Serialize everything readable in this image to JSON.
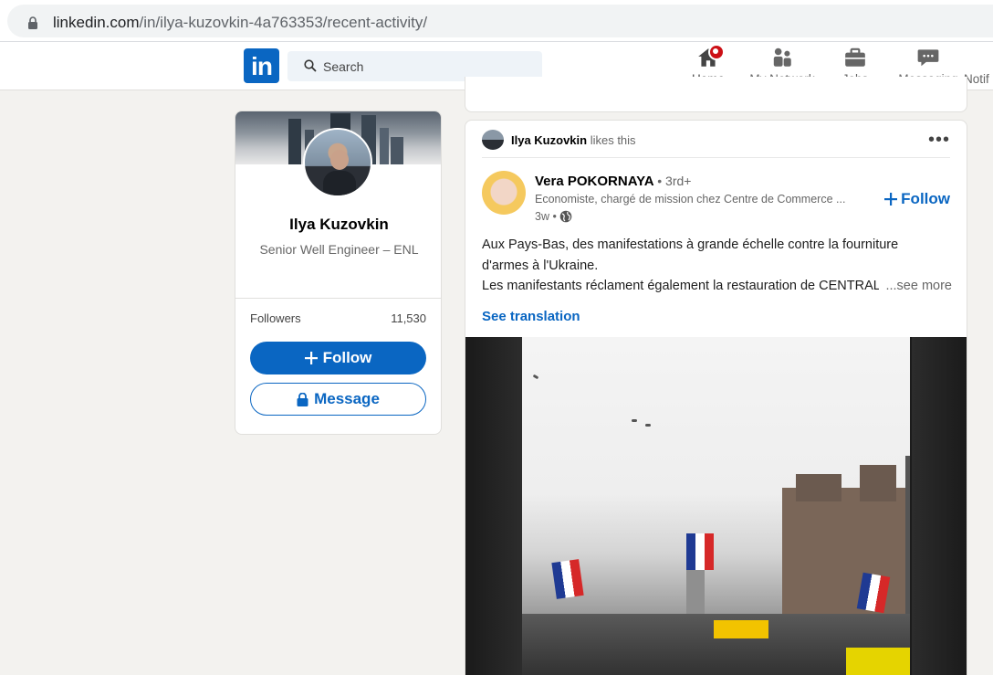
{
  "browser": {
    "url_domain": "linkedin.com",
    "url_path": "/in/ilya-kuzovkin-4a763353/recent-activity/"
  },
  "nav": {
    "logo": "in",
    "search_placeholder": "Search",
    "items": [
      {
        "label": "Home"
      },
      {
        "label": "My Network"
      },
      {
        "label": "Jobs"
      },
      {
        "label": "Messaging"
      },
      {
        "label": "Notif"
      }
    ]
  },
  "profile": {
    "name": "Ilya Kuzovkin",
    "headline": "Senior Well Engineer – ENL",
    "followers_label": "Followers",
    "followers_count": "11,530",
    "follow_label": "Follow",
    "message_label": "Message"
  },
  "post": {
    "liker_name": "Ilya Kuzovkin",
    "liker_action": "likes this",
    "author_name": "Vera POKORNAYA",
    "author_degree": "• 3rd+",
    "author_headline": "Economiste, chargé de mission chez Centre de Commerce ...",
    "time": "3w •",
    "follow_label": "Follow",
    "body_line1": "Aux Pays-Bas, des manifestations à grande échelle contre la fourniture",
    "body_line2": "d'armes à l'Ukraine.",
    "body_line3": "Les manifestants réclament également la restauration de CENTRALE",
    "see_more": "...see more",
    "see_translation": "See translation"
  },
  "colors": {
    "brand": "#0a66c2",
    "notification_badge": "#cc1016",
    "page_bg": "#f3f2ef"
  }
}
